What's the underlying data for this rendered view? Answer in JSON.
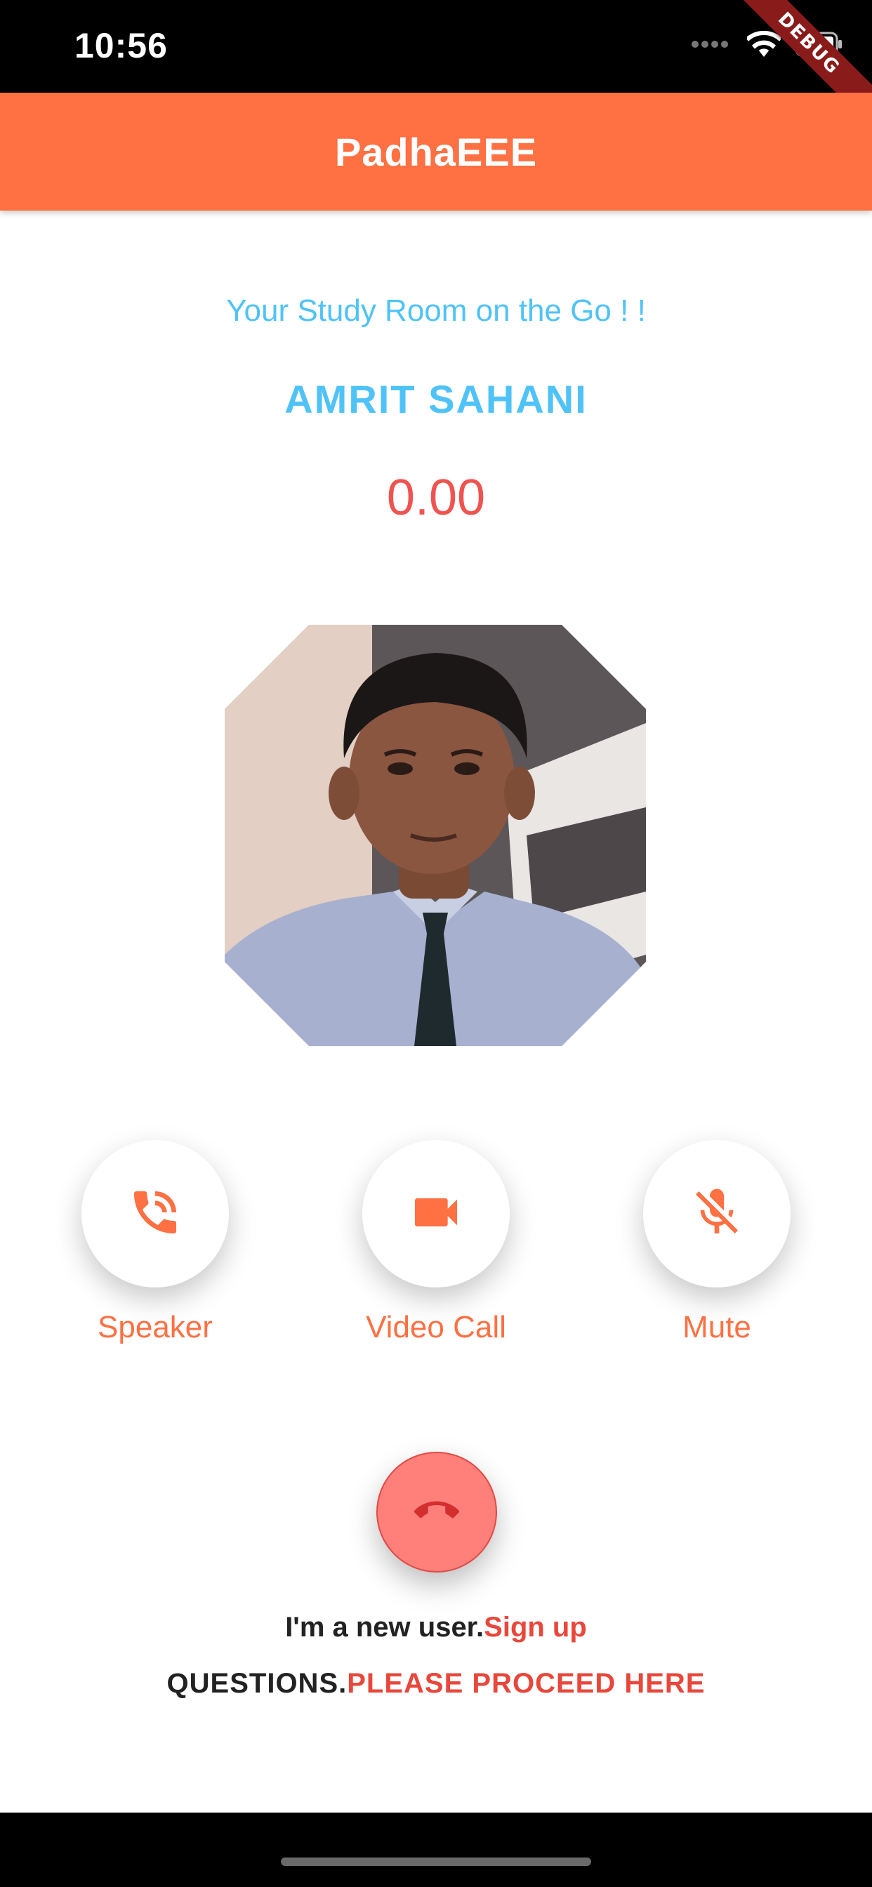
{
  "status_bar": {
    "time": "10:56",
    "debug_banner": "DEBUG"
  },
  "app_bar": {
    "title": "PadhaEEE"
  },
  "call": {
    "tagline": "Your Study Room on the Go ! !",
    "caller_name": "AMRIT SAHANI",
    "timer": "0.00"
  },
  "controls": [
    {
      "label": "Speaker",
      "icon": "phone-in-talk-icon"
    },
    {
      "label": "Video Call",
      "icon": "videocam-icon"
    },
    {
      "label": "Mute",
      "icon": "mic-off-icon"
    }
  ],
  "end_call": {
    "icon": "call-end-icon"
  },
  "footer": {
    "signup_prefix": "I'm a new user.",
    "signup_link": "Sign up",
    "questions_prefix": "QUESTIONS.",
    "questions_link": "PLEASE PROCEED HERE"
  },
  "colors": {
    "accent": "#ff7043",
    "title_blue": "#4fc3f7",
    "timer_red": "#ef5350",
    "end_call": "#ff7f7b"
  }
}
